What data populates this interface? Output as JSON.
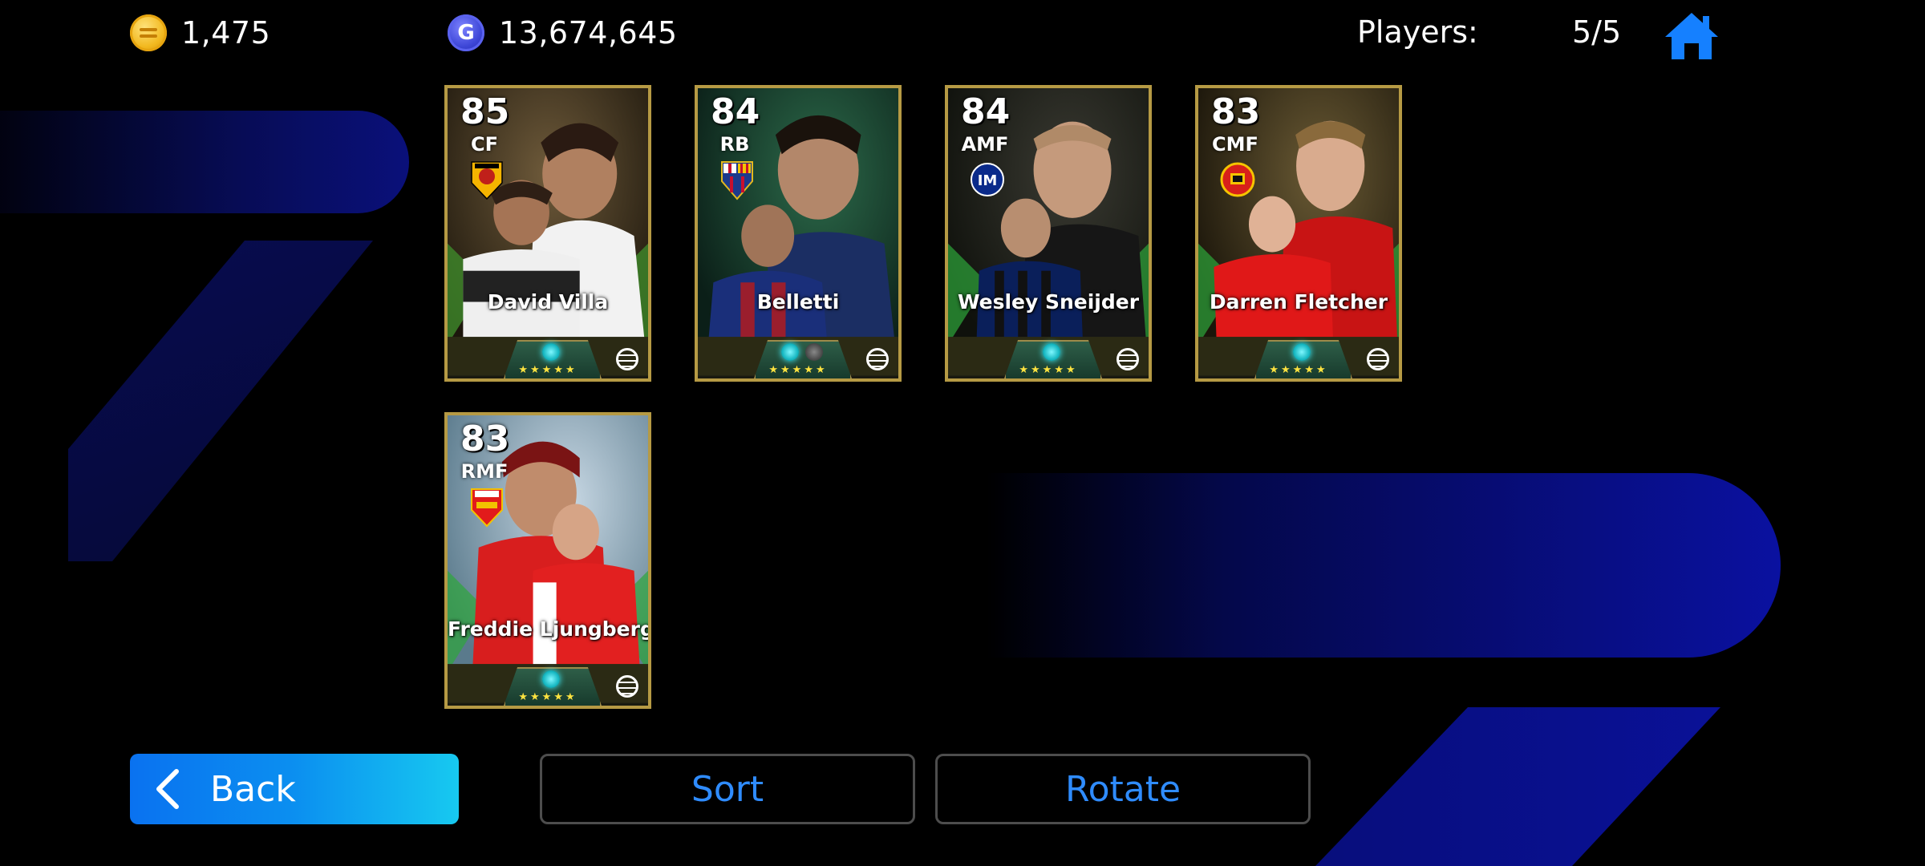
{
  "header": {
    "coins": "1,475",
    "gp": "13,674,645",
    "gp_icon_letter": "G",
    "players_label": "Players:",
    "players_count": "5/5",
    "icons": {
      "coins": "efootball-coin-icon",
      "gp": "gp-icon",
      "home": "home-icon"
    }
  },
  "cards": [
    {
      "rating": "85",
      "position": "CF",
      "name": "David Villa",
      "stars": "★★★★★",
      "club_icon": "valencia-crest-icon"
    },
    {
      "rating": "84",
      "position": "RB",
      "name": "Belletti",
      "stars": "★★★★★",
      "club_icon": "barcelona-crest-icon"
    },
    {
      "rating": "84",
      "position": "AMF",
      "name": "Wesley Sneijder",
      "stars": "★★★★★",
      "club_icon": "inter-crest-icon"
    },
    {
      "rating": "83",
      "position": "CMF",
      "name": "Darren Fletcher",
      "stars": "★★★★★",
      "club_icon": "manutd-crest-icon"
    },
    {
      "rating": "83",
      "position": "RMF",
      "name": "Freddie Ljungberg",
      "stars": "★★★★★",
      "club_icon": "arsenal-crest-icon"
    }
  ],
  "buttons": {
    "back": "Back",
    "sort": "Sort",
    "rotate": "Rotate"
  },
  "colors": {
    "accent_blue": "#2f8cff",
    "back_gradient_start": "#0a72f0",
    "back_gradient_end": "#17c9f0",
    "card_border_gold": "#b69a44",
    "star_yellow": "#ffe340"
  }
}
